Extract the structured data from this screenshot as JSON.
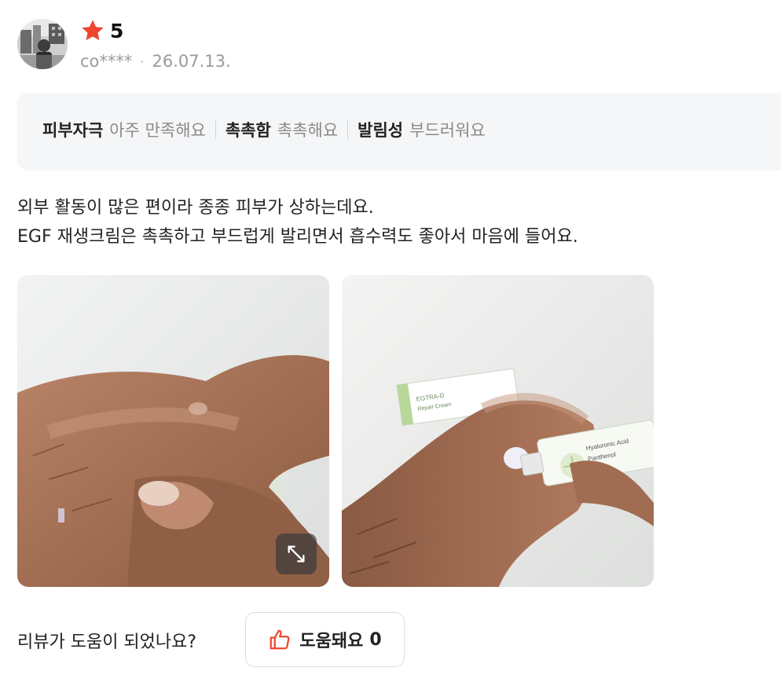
{
  "review": {
    "rating": "5",
    "user": "co****",
    "separator": "·",
    "date": "26.07.13.",
    "attributes": [
      {
        "key": "피부자극",
        "value": "아주 만족해요"
      },
      {
        "key": "촉촉함",
        "value": "촉촉해요"
      },
      {
        "key": "발림성",
        "value": "부드러워요"
      }
    ],
    "text_lines": [
      "외부 활동이 많은 편이라 종종 피부가 상하는데요.",
      "EGF 재생크림은 촉촉하고 부드럽게 발리면서 흡수력도 좋아서 마음에 들어요."
    ],
    "photos": [
      {
        "icon": "hand-with-cream-photo"
      },
      {
        "icon": "hand-applying-cream-tube-photo",
        "tube_label": "EGTRA-D Repair Cream"
      }
    ]
  },
  "helpful": {
    "question": "리뷰가 도움이 되었나요?",
    "button_label": "도움돼요",
    "count": "0"
  },
  "colors": {
    "star": "#f0452f",
    "thumb": "#f0452f",
    "attr_bg": "#f5f6f8"
  }
}
